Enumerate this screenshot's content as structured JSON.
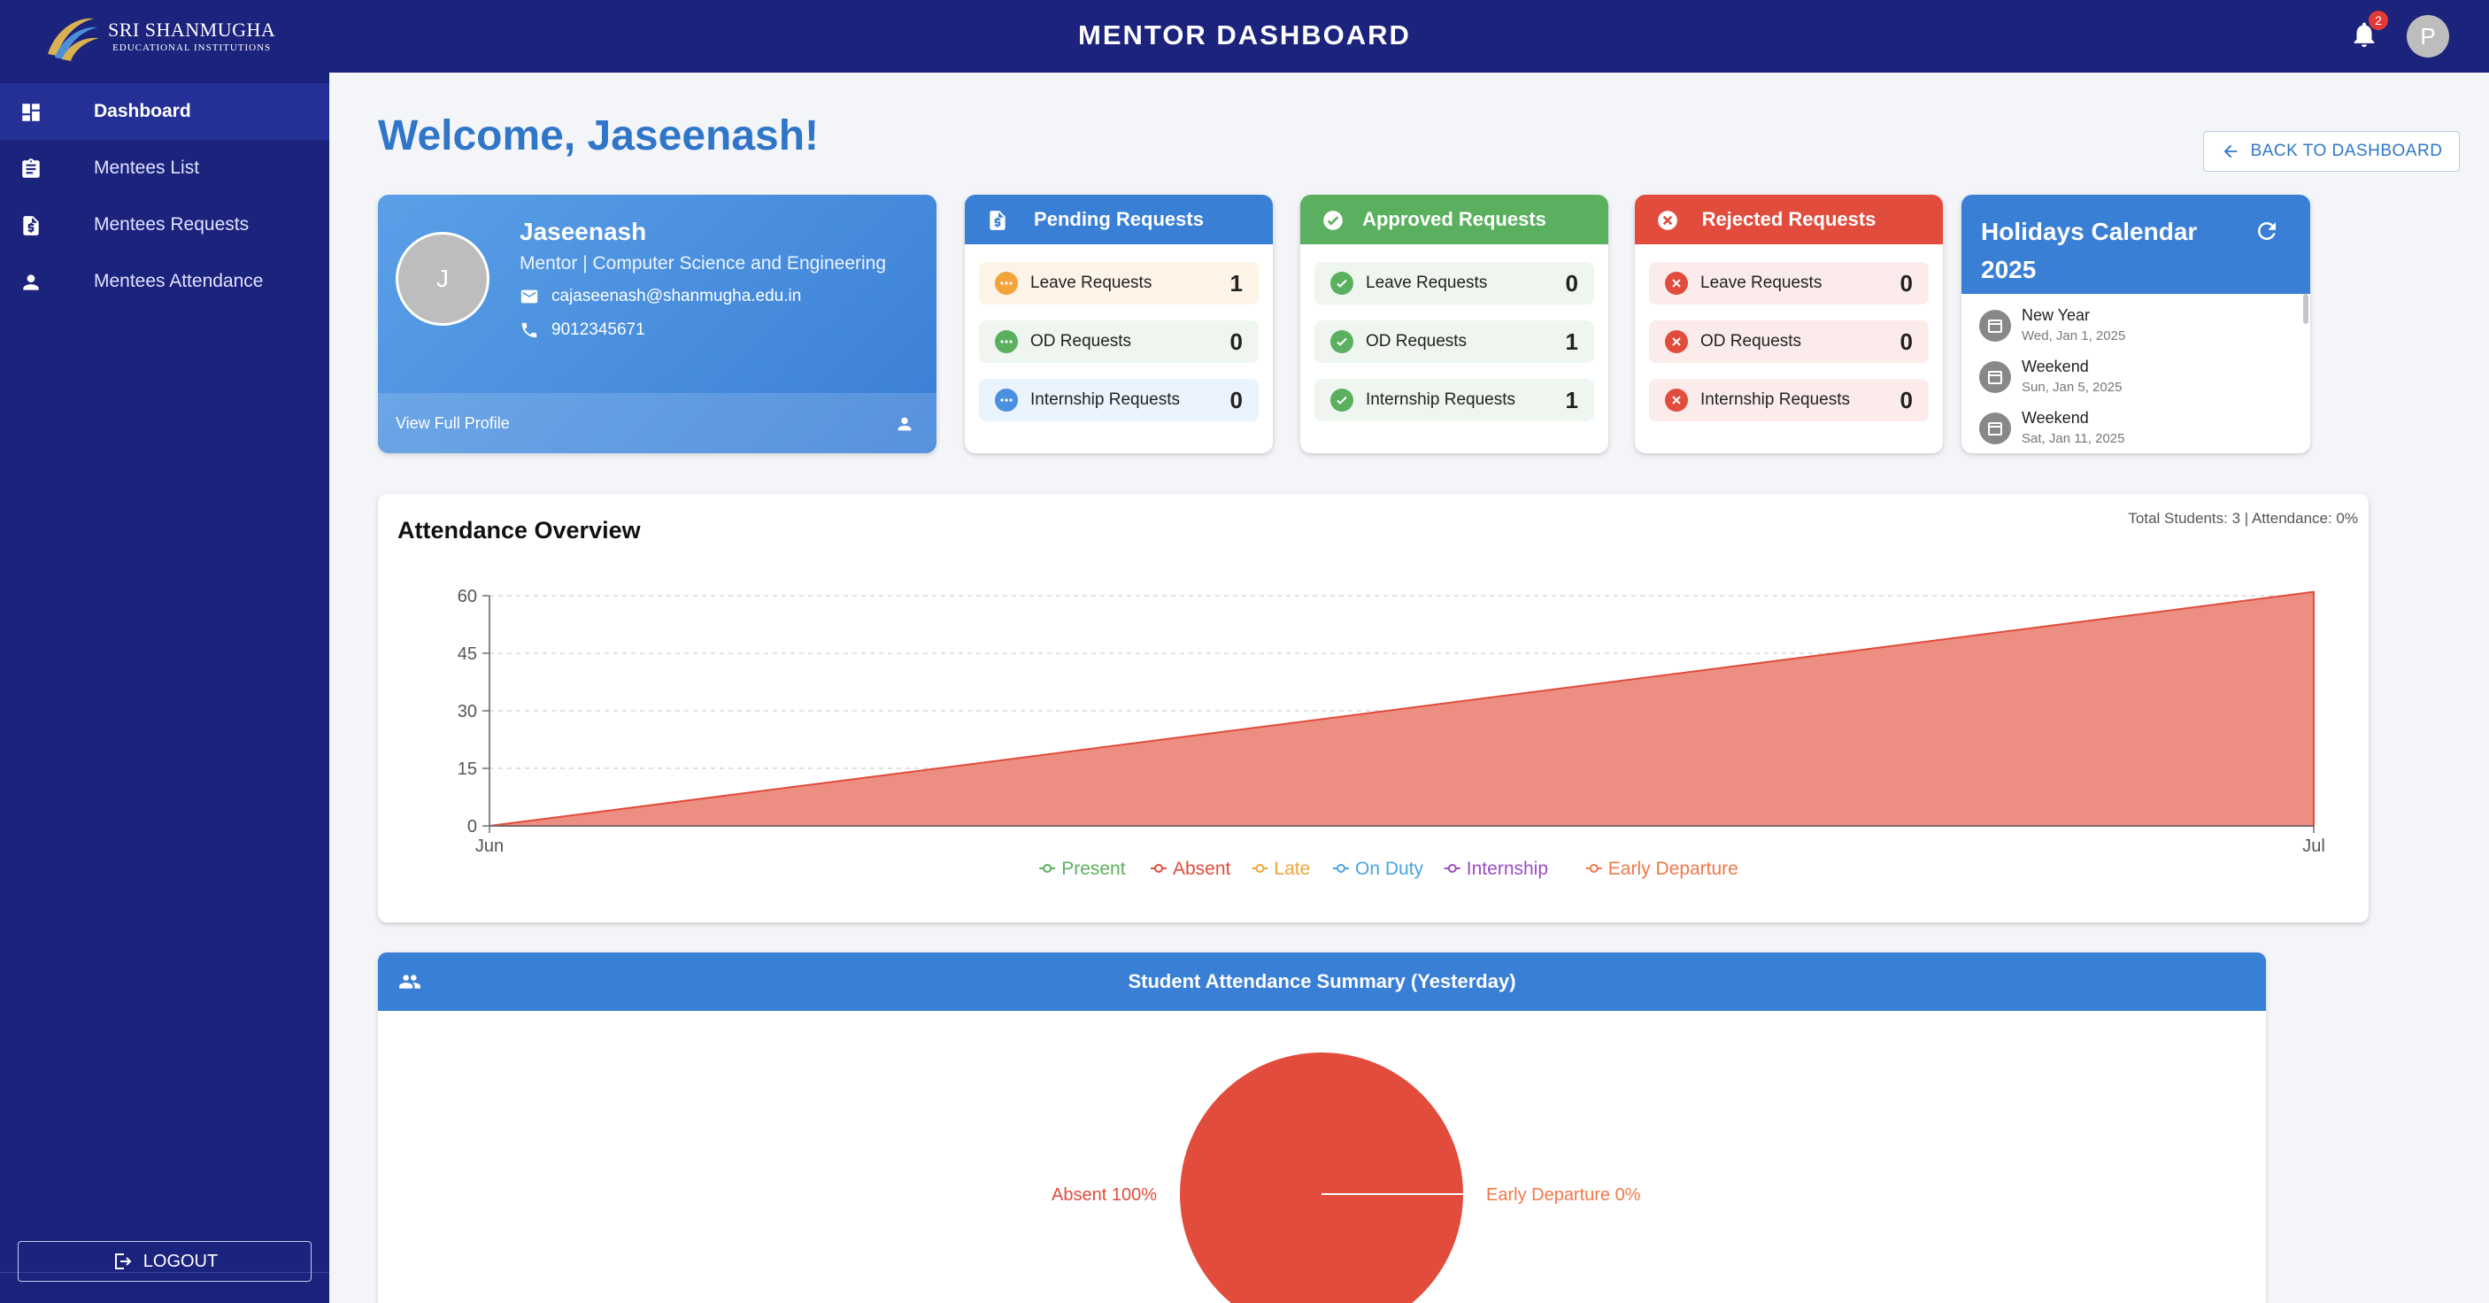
{
  "header": {
    "brand_line1": "SRI SHANMUGHA",
    "brand_line2": "EDUCATIONAL INSTITUTIONS",
    "title": "MENTOR DASHBOARD",
    "notification_count": "2",
    "user_initial": "P"
  },
  "sidebar": {
    "items": [
      {
        "label": "Dashboard",
        "icon": "dashboard-icon",
        "active": true
      },
      {
        "label": "Mentees List",
        "icon": "clipboard-icon"
      },
      {
        "label": "Mentees Requests",
        "icon": "document-dollar-icon"
      },
      {
        "label": "Mentees Attendance",
        "icon": "person-icon"
      }
    ],
    "logout_label": "LOGOUT"
  },
  "main": {
    "welcome": "Welcome, Jaseenash!",
    "back_label": "BACK TO DASHBOARD"
  },
  "profile": {
    "initial": "J",
    "name": "Jaseenash",
    "role": "Mentor | Computer Science and Engineering",
    "email": "cajaseenash@shanmugha.edu.in",
    "phone": "9012345671",
    "view_profile": "View Full Profile"
  },
  "requests": {
    "pending": {
      "title": "Pending Requests",
      "color": "#3a7fd6",
      "rows": [
        {
          "label": "Leave Requests",
          "count": "1"
        },
        {
          "label": "OD Requests",
          "count": "0"
        },
        {
          "label": "Internship Requests",
          "count": "0"
        }
      ]
    },
    "approved": {
      "title": "Approved Requests",
      "color": "#5ab05e",
      "rows": [
        {
          "label": "Leave Requests",
          "count": "0"
        },
        {
          "label": "OD Requests",
          "count": "1"
        },
        {
          "label": "Internship Requests",
          "count": "1"
        }
      ]
    },
    "rejected": {
      "title": "Rejected Requests",
      "color": "#e14c3c",
      "rows": [
        {
          "label": "Leave Requests",
          "count": "0"
        },
        {
          "label": "OD Requests",
          "count": "0"
        },
        {
          "label": "Internship Requests",
          "count": "0"
        }
      ]
    }
  },
  "holidays": {
    "title_line1": "Holidays Calendar",
    "title_line2": "2025",
    "items": [
      {
        "name": "New Year",
        "date": "Wed, Jan 1, 2025"
      },
      {
        "name": "Weekend",
        "date": "Sun, Jan 5, 2025"
      },
      {
        "name": "Weekend",
        "date": "Sat, Jan 11, 2025"
      }
    ]
  },
  "attendance": {
    "title": "Attendance Overview",
    "meta": "Total Students: 3  | Attendance: 0%"
  },
  "chart_data": [
    {
      "type": "area",
      "title": "Attendance Overview",
      "x": [
        "Jun",
        "Jul"
      ],
      "ylim": [
        0,
        60
      ],
      "yticks": [
        "0",
        "15",
        "30",
        "45",
        "60"
      ],
      "series": [
        {
          "name": "Present",
          "color": "#5ab05e",
          "values": [
            0,
            0
          ]
        },
        {
          "name": "Absent",
          "color": "#e14c3c",
          "values": [
            0,
            61
          ]
        },
        {
          "name": "Late",
          "color": "#f2a33a",
          "values": [
            0,
            0
          ]
        },
        {
          "name": "On Duty",
          "color": "#4aa3df",
          "values": [
            0,
            0
          ]
        },
        {
          "name": "Internship",
          "color": "#9b4dc2",
          "values": [
            0,
            0
          ]
        },
        {
          "name": "Early Departure",
          "color": "#f0784a",
          "values": [
            0,
            0
          ]
        }
      ],
      "grid": true,
      "legend": "bottom"
    },
    {
      "type": "pie",
      "title": "Student Attendance Summary (Yesterday)",
      "slices": [
        {
          "label": "Absent 100%",
          "value": 100,
          "color": "#e14c3c"
        },
        {
          "label": "Early Departure 0%",
          "value": 0,
          "color": "#f0784a"
        }
      ]
    }
  ]
}
